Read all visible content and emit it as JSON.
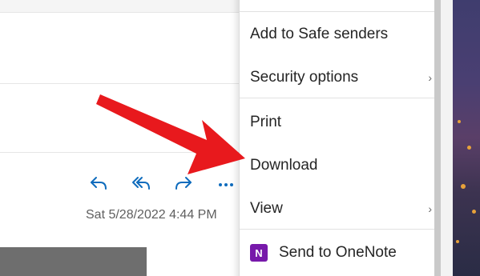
{
  "menu": {
    "items": [
      {
        "label": "Add to Safe senders",
        "has_submenu": false
      },
      {
        "label": "Security options",
        "has_submenu": true
      },
      {
        "label": "Print",
        "has_submenu": false
      },
      {
        "label": "Download",
        "has_submenu": false
      },
      {
        "label": "View",
        "has_submenu": true
      },
      {
        "label": "Send to OneNote",
        "has_submenu": false,
        "icon": "onenote-icon"
      }
    ],
    "chevron": "›"
  },
  "email": {
    "date": "Sat 5/28/2022 4:44 PM",
    "actions": [
      {
        "name": "reply",
        "icon": "reply-icon"
      },
      {
        "name": "reply-all",
        "icon": "reply-all-icon"
      },
      {
        "name": "forward",
        "icon": "forward-icon"
      },
      {
        "name": "more",
        "icon": "more-icon"
      }
    ]
  },
  "colors": {
    "accent": "#0f6cbd",
    "arrow": "#e8191d",
    "onenote": "#7719aa"
  }
}
